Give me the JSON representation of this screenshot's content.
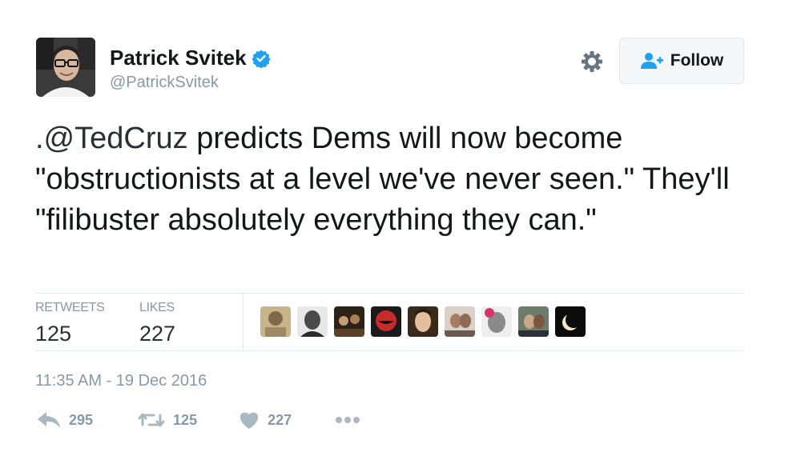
{
  "user": {
    "display_name": "Patrick Svitek",
    "handle": "@PatrickSvitek",
    "verified": true
  },
  "follow_button": {
    "label": "Follow",
    "icon": "add-user-icon"
  },
  "settings": {
    "icon": "gear-icon"
  },
  "tweet": {
    "mention": ".@TedCruz",
    "text": " predicts Dems will now become \"obstructionists at a level we've never seen.\" They'll \"filibuster absolutely everything they can.\""
  },
  "stats": {
    "retweets_label": "RETWEETS",
    "retweets_value": "125",
    "likes_label": "LIKES",
    "likes_value": "227"
  },
  "likers": [
    {
      "name": "liker-avatar-1",
      "color": "#b7a27c"
    },
    {
      "name": "liker-avatar-2",
      "color": "#5a5a5a"
    },
    {
      "name": "liker-avatar-3",
      "color": "#4a3a2e"
    },
    {
      "name": "liker-avatar-4",
      "color": "#b8232b"
    },
    {
      "name": "liker-avatar-5",
      "color": "#3b3028"
    },
    {
      "name": "liker-avatar-6",
      "color": "#8b7c70"
    },
    {
      "name": "liker-avatar-7",
      "color": "#9a9a9a"
    },
    {
      "name": "liker-avatar-8",
      "color": "#556055"
    },
    {
      "name": "liker-avatar-9",
      "color": "#111111"
    }
  ],
  "timestamp": "11:35 AM - 19 Dec 2016",
  "actions": {
    "reply_count": "295",
    "retweet_count": "125",
    "like_count": "227"
  },
  "colors": {
    "text": "#14171a",
    "muted": "#8899a6",
    "verified": "#1da1f2",
    "divider": "#e1e8ed"
  }
}
